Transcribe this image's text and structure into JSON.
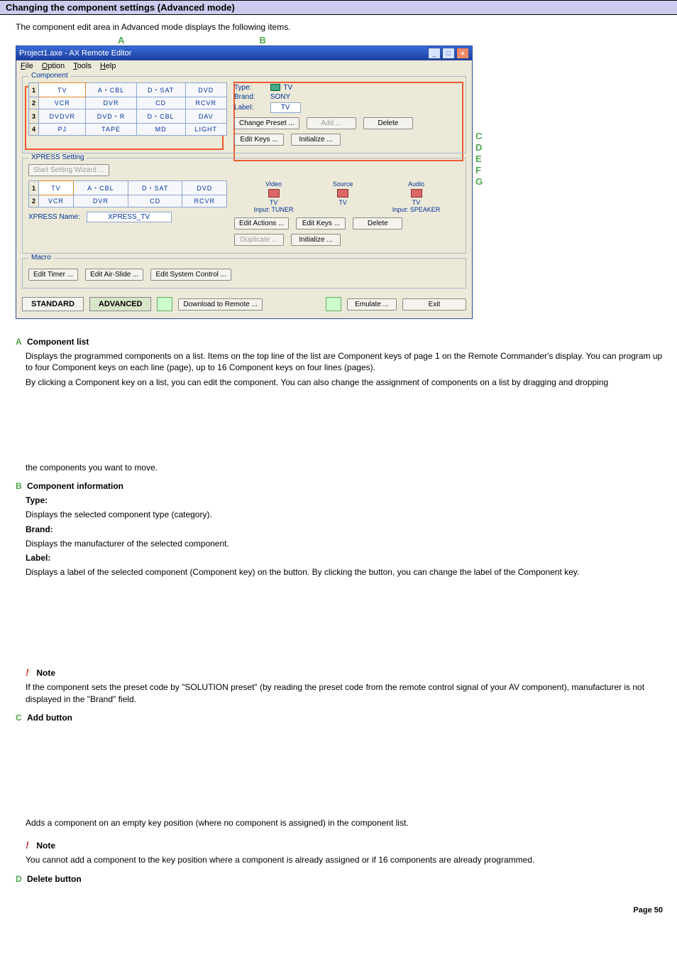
{
  "heading": "Changing the component settings (Advanced mode)",
  "intro": "The component edit area in Advanced mode displays the following items.",
  "callouts": {
    "A": "A",
    "B": "B",
    "C": "C",
    "D": "D",
    "E": "E",
    "F": "F",
    "G": "G"
  },
  "window": {
    "title": "Project1.axe - AX Remote Editor",
    "menu": [
      "File",
      "Option",
      "Tools",
      "Help"
    ],
    "group_component": "Component",
    "grid_main": [
      [
        "1",
        "TV",
        "A・CBL",
        "D・SAT",
        "DVD"
      ],
      [
        "2",
        "VCR",
        "DVR",
        "CD",
        "RCVR"
      ],
      [
        "3",
        "DVDVR",
        "DVD・R",
        "D・CBL",
        "DAV"
      ],
      [
        "4",
        "PJ",
        "TAPE",
        "MD",
        "LIGHT"
      ]
    ],
    "info": {
      "type_k": "Type:",
      "type_v": "TV",
      "brand_k": "Brand:",
      "brand_v": "SONY",
      "label_k": "Label:",
      "label_v": "TV"
    },
    "btns": {
      "change_preset": "Change Preset ...",
      "add": "Add ...",
      "delete": "Delete",
      "edit_keys": "Edit Keys ...",
      "initialize": "Initialize ..."
    },
    "group_xpress": "XPRESS Setting",
    "start_wizard": "Start Setting Wizard ...",
    "grid_xpress": [
      [
        "1",
        "TV",
        "A・CBL",
        "D・SAT",
        "DVD"
      ],
      [
        "2",
        "VCR",
        "DVR",
        "CD",
        "RCVR"
      ]
    ],
    "xpress_name_k": "XPRESS Name:",
    "xpress_name_v": "XPRESS_TV",
    "avs": {
      "video": "Video",
      "source": "Source",
      "audio": "Audio",
      "tv": "TV",
      "input_tuner": "Input: TUNER",
      "input_speaker": "Input: SPEAKER"
    },
    "xbtns": {
      "edit_actions": "Edit Actions ...",
      "edit_keys": "Edit Keys ...",
      "delete": "Delete",
      "duplicate": "Duplicate ...",
      "initialize": "Initialize ..."
    },
    "group_macro": "Macro",
    "macro_btns": {
      "edit_timer": "Edit Timer ...",
      "edit_airslide": "Edit Air-Slide ...",
      "edit_syscontrol": "Edit System Control ..."
    },
    "tabs": {
      "standard": "STANDARD",
      "advanced": "ADVANCED"
    },
    "bottom": {
      "download": "Download to Remote ...",
      "emulate": "Emulate ...",
      "exit": "Exit"
    }
  },
  "sections": {
    "A": {
      "title": "Component list",
      "p1": "Displays the programmed components on a list. Items on the top line of the list are Component keys of page 1 on the Remote Commander's display. You can program up to four Component keys on each line (page), up to 16 Component keys on four lines (pages).",
      "p2": "By clicking a Component key on a list, you can edit the component. You can also change the assignment of components on a list by dragging and dropping",
      "p3": "the components you want to move."
    },
    "B": {
      "title": "Component information",
      "type_k": "Type:",
      "type_d": "Displays the selected component type (category).",
      "brand_k": "Brand:",
      "brand_d": "Displays the manufacturer of the selected component.",
      "label_k": "Label:",
      "label_d": "Displays a label of the selected component (Component key) on the button. By clicking the button, you can change the label of the Component key.",
      "note_t": "Note",
      "note_d": "If the component sets the preset code by \"SOLUTION preset\" (by reading the preset code from the remote control signal of your AV component), manufacturer is not displayed in the \"Brand\" field."
    },
    "C": {
      "title": "Add button",
      "p1": "Adds a component on an empty key position (where no component is assigned) in the component list.",
      "note_t": "Note",
      "note_d": "You cannot add a component to the key position where a component is already assigned or if 16 components are already programmed."
    },
    "D": {
      "title": "Delete button"
    }
  },
  "page_label": "Page 50"
}
